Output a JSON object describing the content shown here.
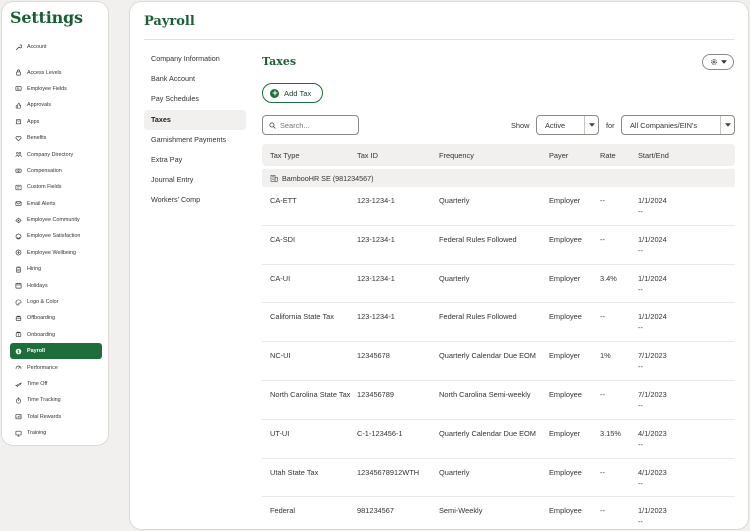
{
  "settings": {
    "title": "Settings",
    "items": [
      {
        "label": "Account",
        "icon": "wrench-icon",
        "gap": false
      },
      {
        "label": "Access Levels",
        "icon": "lock-icon",
        "gap": true
      },
      {
        "label": "Employee Fields",
        "icon": "id-card-icon",
        "gap": false
      },
      {
        "label": "Approvals",
        "icon": "thumbs-up-icon",
        "gap": false
      },
      {
        "label": "Apps",
        "icon": "apps-icon",
        "gap": false
      },
      {
        "label": "Benefits",
        "icon": "heart-icon",
        "gap": false
      },
      {
        "label": "Company Directory",
        "icon": "people-icon",
        "gap": false
      },
      {
        "label": "Compensation",
        "icon": "money-icon",
        "gap": false
      },
      {
        "label": "Custom Fields",
        "icon": "fields-icon",
        "gap": false
      },
      {
        "label": "Email Alerts",
        "icon": "envelope-icon",
        "gap": false
      },
      {
        "label": "Employee Community",
        "icon": "community-icon",
        "gap": false
      },
      {
        "label": "Employee Satisfaction",
        "icon": "smile-icon",
        "gap": false
      },
      {
        "label": "Employee Wellbeing",
        "icon": "wellbeing-icon",
        "gap": false
      },
      {
        "label": "Hiring",
        "icon": "clipboard-icon",
        "gap": false
      },
      {
        "label": "Holidays",
        "icon": "calendar-icon",
        "gap": false
      },
      {
        "label": "Logo & Color",
        "icon": "palette-icon",
        "gap": false
      },
      {
        "label": "Offboarding",
        "icon": "offboarding-icon",
        "gap": false
      },
      {
        "label": "Onboarding",
        "icon": "onboarding-icon",
        "gap": false
      },
      {
        "label": "Payroll",
        "icon": "dollar-icon",
        "gap": false,
        "active": true
      },
      {
        "label": "Performance",
        "icon": "gauge-icon",
        "gap": false
      },
      {
        "label": "Time Off",
        "icon": "plane-icon",
        "gap": false
      },
      {
        "label": "Time Tracking",
        "icon": "stopwatch-icon",
        "gap": false
      },
      {
        "label": "Total Rewards",
        "icon": "rewards-icon",
        "gap": false
      },
      {
        "label": "Training",
        "icon": "training-icon",
        "gap": false
      }
    ]
  },
  "page": {
    "title": "Payroll",
    "section_title": "Taxes",
    "add_button": "Add Tax"
  },
  "subnav": [
    {
      "label": "Company Information"
    },
    {
      "label": "Bank Account"
    },
    {
      "label": "Pay Schedules"
    },
    {
      "label": "Taxes",
      "active": true
    },
    {
      "label": "Garnishment Payments"
    },
    {
      "label": "Extra Pay"
    },
    {
      "label": "Journal Entry"
    },
    {
      "label": "Workers' Comp"
    }
  ],
  "filters": {
    "search_placeholder": "Search...",
    "show_label": "Show",
    "show_value": "Active",
    "for_label": "for",
    "company_value": "All Companies/EIN's"
  },
  "table": {
    "columns": [
      "Tax Type",
      "Tax ID",
      "Frequency",
      "Payer",
      "Rate",
      "Start/End"
    ],
    "group": "BambooHR SE (981234567)",
    "rows": [
      {
        "type": "CA-ETT",
        "id": "123-1234-1",
        "freq": "Quarterly",
        "payer": "Employer",
        "rate": "--",
        "start": "1/1/2024",
        "end": "--"
      },
      {
        "type": "CA-SDI",
        "id": "123-1234-1",
        "freq": "Federal Rules Followed",
        "payer": "Employee",
        "rate": "--",
        "start": "1/1/2024",
        "end": "--"
      },
      {
        "type": "CA-UI",
        "id": "123-1234-1",
        "freq": "Quarterly",
        "payer": "Employer",
        "rate": "3.4%",
        "start": "1/1/2024",
        "end": "--"
      },
      {
        "type": "California State Tax",
        "id": "123-1234-1",
        "freq": "Federal Rules Followed",
        "payer": "Employee",
        "rate": "--",
        "start": "1/1/2024",
        "end": "--"
      },
      {
        "type": "NC-UI",
        "id": "12345678",
        "freq": "Quarterly Calendar Due EOM",
        "payer": "Employer",
        "rate": "1%",
        "start": "7/1/2023",
        "end": "--"
      },
      {
        "type": "North Carolina State Tax",
        "id": "123456789",
        "freq": "North Carolina Semi-weekly",
        "payer": "Employee",
        "rate": "--",
        "start": "7/1/2023",
        "end": "--"
      },
      {
        "type": "UT-UI",
        "id": "C-1-123456-1",
        "freq": "Quarterly Calendar Due EOM",
        "payer": "Employer",
        "rate": "3.15%",
        "start": "4/1/2023",
        "end": "--"
      },
      {
        "type": "Utah State Tax",
        "id": "12345678912WTH",
        "freq": "Quarterly",
        "payer": "Employee",
        "rate": "--",
        "start": "4/1/2023",
        "end": "--"
      },
      {
        "type": "Federal",
        "id": "981234567",
        "freq": "Semi-Weekly",
        "payer": "Employee",
        "rate": "--",
        "start": "1/1/2023",
        "end": "--"
      }
    ]
  },
  "colors": {
    "brand": "#1b5e36",
    "active_bg": "#1e6d3c"
  }
}
